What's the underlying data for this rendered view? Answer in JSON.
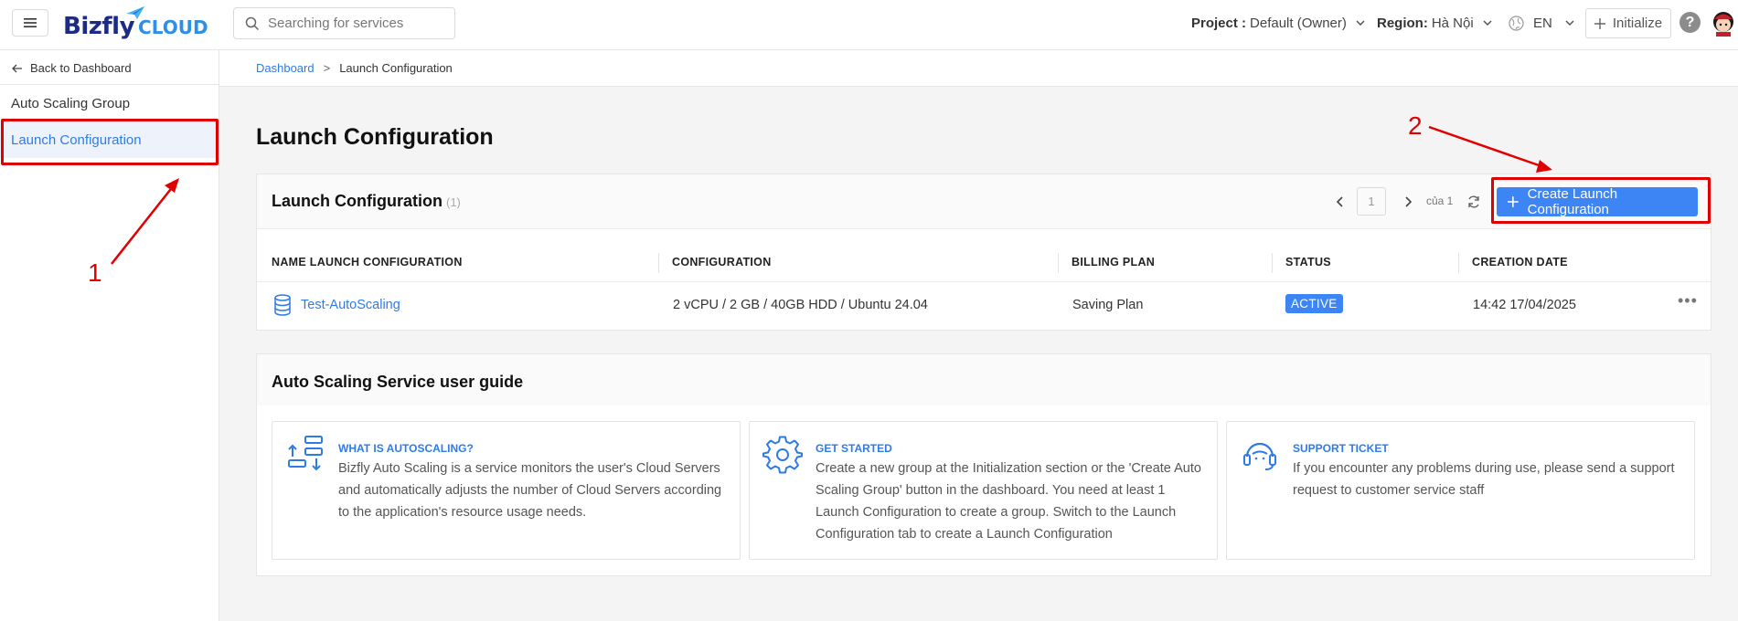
{
  "header": {
    "logo_main": "Bizfly",
    "logo_sub": "CLOUD",
    "search_placeholder": "Searching for services",
    "project_label": "Project :",
    "project_value": "Default (Owner)",
    "region_label": "Region:",
    "region_value": "Hà Nội",
    "language": "EN",
    "initialize_label": "Initialize",
    "help_label": "?"
  },
  "sidebar": {
    "back_label": "Back to Dashboard",
    "items": [
      {
        "label": "Auto Scaling Group",
        "active": false
      },
      {
        "label": "Launch Configuration",
        "active": true
      }
    ]
  },
  "breadcrumb": {
    "items": [
      "Dashboard",
      "Launch Configuration"
    ],
    "separator": ">"
  },
  "page": {
    "title": "Launch Configuration"
  },
  "launch_table": {
    "title": "Launch Configuration",
    "count": "(1)",
    "pagination": {
      "current": "1",
      "of_label": "của 1"
    },
    "create_button": "Create Launch Configuration",
    "columns": [
      "NAME LAUNCH CONFIGURATION",
      "CONFIGURATION",
      "BILLING PLAN",
      "STATUS",
      "CREATION DATE"
    ],
    "rows": [
      {
        "name": "Test-AutoScaling",
        "configuration": "2 vCPU / 2 GB / 40GB HDD / Ubuntu 24.04",
        "billing_plan": "Saving Plan",
        "status": "ACTIVE",
        "creation_date": "14:42 17/04/2025"
      }
    ]
  },
  "guide": {
    "title": "Auto Scaling Service user guide",
    "cards": [
      {
        "icon": "autoscaling-icon",
        "title": "WHAT IS AUTOSCALING?",
        "text": "Bizfly Auto Scaling is a service monitors the user's Cloud Servers and automatically adjusts the number of Cloud Servers according to the application's resource usage needs."
      },
      {
        "icon": "gear-icon",
        "title": "GET STARTED",
        "text": "Create a new group at the Initialization section or the 'Create Auto Scaling Group' button in the dashboard. You need at least 1 Launch Configuration to create a group. Switch to the Launch Configuration tab to create a Launch Configuration"
      },
      {
        "icon": "headset-icon",
        "title": "SUPPORT TICKET",
        "text": "If you encounter any problems during use, please send a support request to customer service staff"
      }
    ]
  },
  "annotations": {
    "label_1": "1",
    "label_2": "2",
    "color": "#e00000"
  },
  "colors": {
    "accent": "#3d85f4",
    "link": "#2f7be5",
    "brand_dark": "#1b2b86"
  }
}
